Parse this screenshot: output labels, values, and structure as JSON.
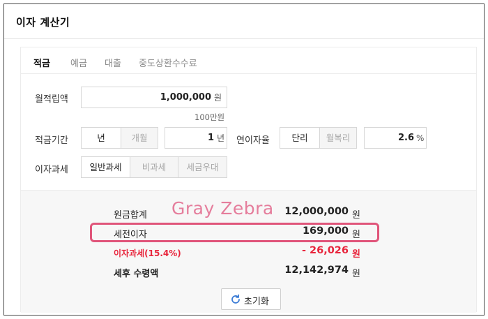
{
  "header": {
    "title": "이자 계산기"
  },
  "tabs": [
    {
      "label": "적금"
    },
    {
      "label": "예금"
    },
    {
      "label": "대출"
    },
    {
      "label": "중도상환수수료"
    }
  ],
  "form": {
    "monthly": {
      "label": "월적립액",
      "value": "1,000,000",
      "unit": "원",
      "hint": "100만원"
    },
    "period": {
      "label": "적금기간",
      "opt_year": "년",
      "opt_month": "개월",
      "value": "1",
      "unit": "년"
    },
    "rate": {
      "label": "연이자율",
      "opt_simple": "단리",
      "opt_compound": "월복리",
      "value": "2.6",
      "unit": "%"
    },
    "tax": {
      "label": "이자과세",
      "opt_general": "일반과세",
      "opt_exempt": "비과세",
      "opt_preferential": "세금우대"
    }
  },
  "results": {
    "principal": {
      "label": "원금합계",
      "value": "12,000,000",
      "unit": "원"
    },
    "pretax": {
      "label": "세전이자",
      "value": "169,000",
      "unit": "원"
    },
    "tax": {
      "label": "이자과세(15.4%)",
      "value": "- 26,026",
      "unit": "원"
    },
    "net": {
      "label": "세후 수령액",
      "value": "12,142,974",
      "unit": "원"
    }
  },
  "watermark": "Gray Zebra",
  "reset_label": "초기화",
  "colors": {
    "accent_red": "#e8253c",
    "highlight_pink": "#e0557a",
    "border": "#d7d7d7"
  }
}
